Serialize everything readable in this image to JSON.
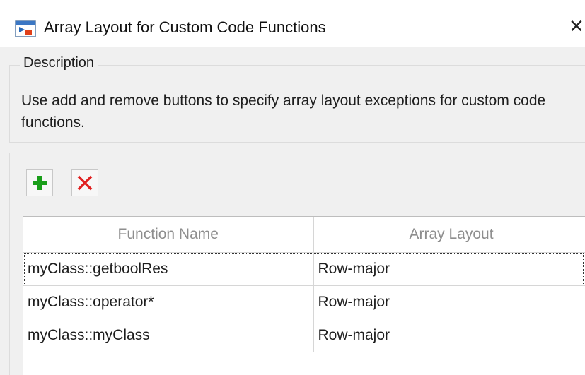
{
  "window": {
    "title": "Array Layout for Custom Code Functions",
    "app_icon": "simulink-app-icon",
    "close_glyph": "✕"
  },
  "description": {
    "legend": "Description",
    "text": "Use add and remove buttons to specify array layout exceptions for custom code functions."
  },
  "toolbar": {
    "add_icon": "plus-icon",
    "remove_icon": "x-icon",
    "add_color": "#1a9e1a",
    "remove_color": "#e02020"
  },
  "table": {
    "columns": [
      "Function Name",
      "Array Layout"
    ],
    "rows": [
      {
        "function_name": "myClass::getboolRes",
        "array_layout": "Row-major"
      },
      {
        "function_name": "myClass::operator*",
        "array_layout": "Row-major"
      },
      {
        "function_name": "myClass::myClass",
        "array_layout": "Row-major"
      }
    ],
    "selected_row": 0
  }
}
